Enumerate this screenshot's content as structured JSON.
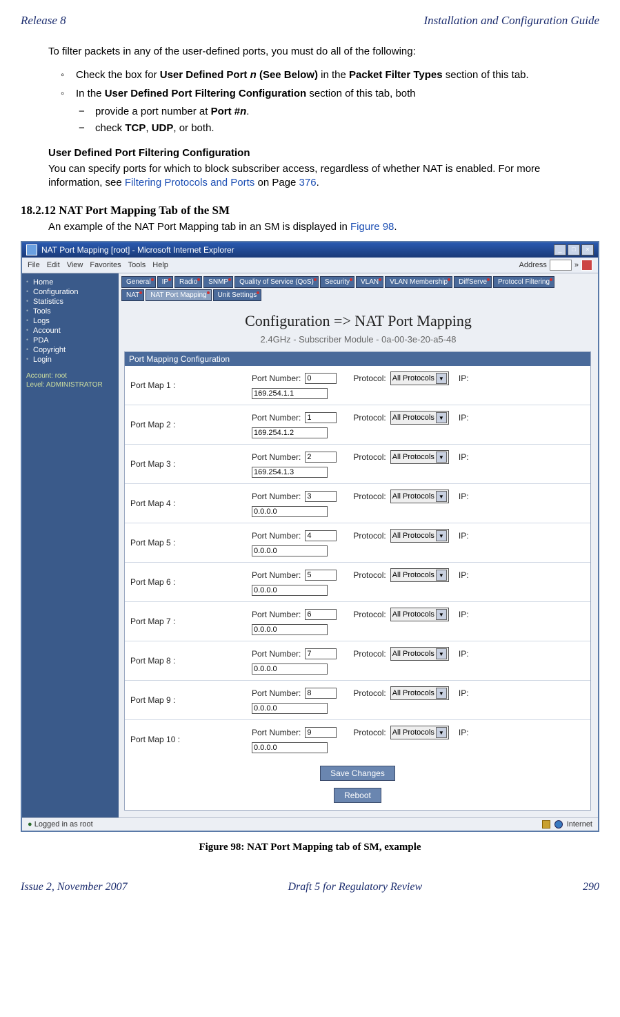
{
  "header": {
    "left": "Release 8",
    "right": "Installation and Configuration Guide"
  },
  "intro": "To filter packets in any of the user-defined ports, you must do all of the following:",
  "bullets": {
    "b1_pre": "Check the box for ",
    "b1_bold1": "User Defined Port ",
    "b1_ital": "n",
    "b1_bold2": " (See Below)",
    "b1_mid": " in the ",
    "b1_bold3": "Packet Filter Types",
    "b1_post": " section of this tab.",
    "b2_pre": "In the ",
    "b2_bold": "User Defined Port Filtering Configuration",
    "b2_post": " section of this tab, both",
    "d1_pre": "provide a port number at ",
    "d1_bold": "Port #",
    "d1_ital": "n",
    "d1_post": ".",
    "d2_pre": "check ",
    "d2_b1": "TCP",
    "d2_sep": ", ",
    "d2_b2": "UDP",
    "d2_post": ", or both."
  },
  "subhead": "User Defined Port Filtering Configuration",
  "subtext_pre": "You can specify ports for which to block subscriber access, regardless of whether NAT is enabled. For more information, see ",
  "subtext_link": "Filtering Protocols and Ports",
  "subtext_mid": " on Page ",
  "subtext_link2": "376",
  "subtext_post": ".",
  "section_num": "18.2.12   NAT Port Mapping Tab of the SM",
  "section_text_pre": "An example of the NAT Port Mapping tab in an SM is displayed in ",
  "section_text_link": "Figure 98",
  "section_text_post": ".",
  "ie": {
    "title": "NAT Port Mapping [root] - Microsoft Internet Explorer",
    "menu": [
      "File",
      "Edit",
      "View",
      "Favorites",
      "Tools",
      "Help"
    ],
    "address_label": "Address",
    "go": "»"
  },
  "sidebar": {
    "items": [
      "Home",
      "Configuration",
      "Statistics",
      "Tools",
      "Logs",
      "Account",
      "PDA",
      "Copyright",
      "Login"
    ],
    "acc1": "Account: root",
    "acc2": "Level: ADMINISTRATOR"
  },
  "tabs_row1": [
    "General",
    "IP",
    "Radio",
    "SNMP",
    "Quality of Service (QoS)",
    "Security",
    "VLAN",
    "VLAN Membership",
    "DiffServe",
    "Protocol Filtering"
  ],
  "tabs_row2": [
    "NAT",
    "NAT Port Mapping",
    "Unit Settings"
  ],
  "page_title": "Configuration => NAT Port Mapping",
  "page_sub": "2.4GHz - Subscriber Module - 0a-00-3e-20-a5-48",
  "panel_head": "Port Mapping Configuration",
  "labels": {
    "port_number": "Port Number:",
    "protocol": "Protocol:",
    "ip": "IP:",
    "all_protocols": "All Protocols"
  },
  "port_maps": [
    {
      "label": "Port Map 1 :",
      "num": "0",
      "ip": "169.254.1.1"
    },
    {
      "label": "Port Map 2 :",
      "num": "1",
      "ip": "169.254.1.2"
    },
    {
      "label": "Port Map 3 :",
      "num": "2",
      "ip": "169.254.1.3"
    },
    {
      "label": "Port Map 4 :",
      "num": "3",
      "ip": "0.0.0.0"
    },
    {
      "label": "Port Map 5 :",
      "num": "4",
      "ip": "0.0.0.0"
    },
    {
      "label": "Port Map 6 :",
      "num": "5",
      "ip": "0.0.0.0"
    },
    {
      "label": "Port Map 7 :",
      "num": "6",
      "ip": "0.0.0.0"
    },
    {
      "label": "Port Map 8 :",
      "num": "7",
      "ip": "0.0.0.0"
    },
    {
      "label": "Port Map 9 :",
      "num": "8",
      "ip": "0.0.0.0"
    },
    {
      "label": "Port Map 10 :",
      "num": "9",
      "ip": "0.0.0.0"
    }
  ],
  "buttons": {
    "save": "Save Changes",
    "reboot": "Reboot"
  },
  "status": {
    "left": "Logged in as root",
    "right": "Internet"
  },
  "caption": "Figure 98: NAT Port Mapping tab of SM, example",
  "footer": {
    "left": "Issue 2, November 2007",
    "center": "Draft 5 for Regulatory Review",
    "right": "290"
  }
}
